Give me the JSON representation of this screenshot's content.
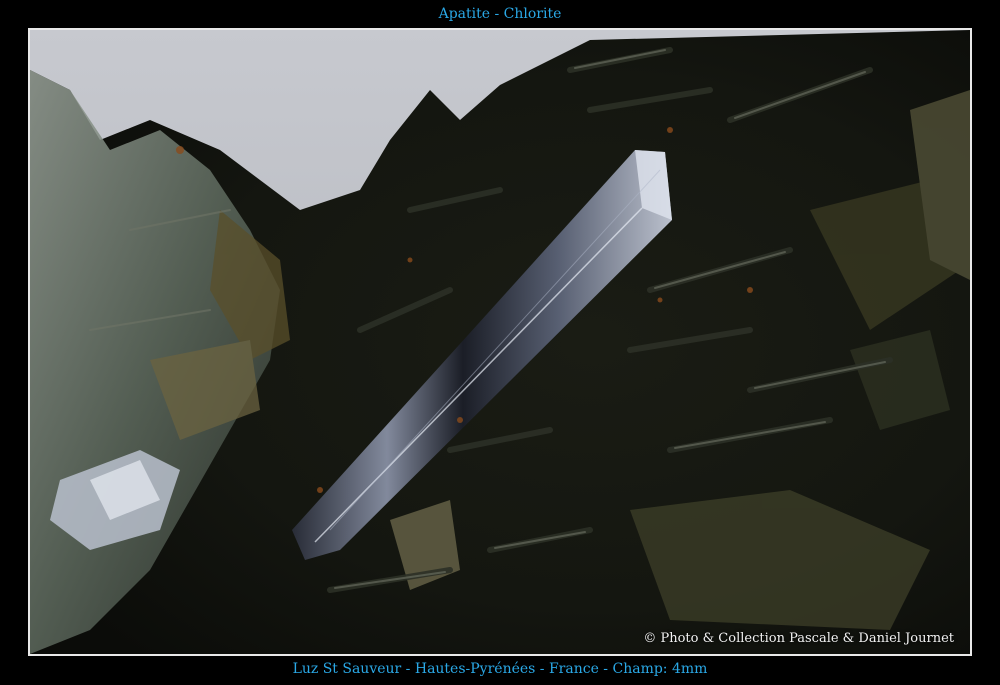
{
  "header": {
    "title": "Apatite - Chlorite"
  },
  "photo": {
    "credit": "© Photo & Collection Pascale & Daniel Journet"
  },
  "footer": {
    "caption": "Luz St Sauveur - Hautes-Pyrénées - France - Champ: 4mm"
  }
}
